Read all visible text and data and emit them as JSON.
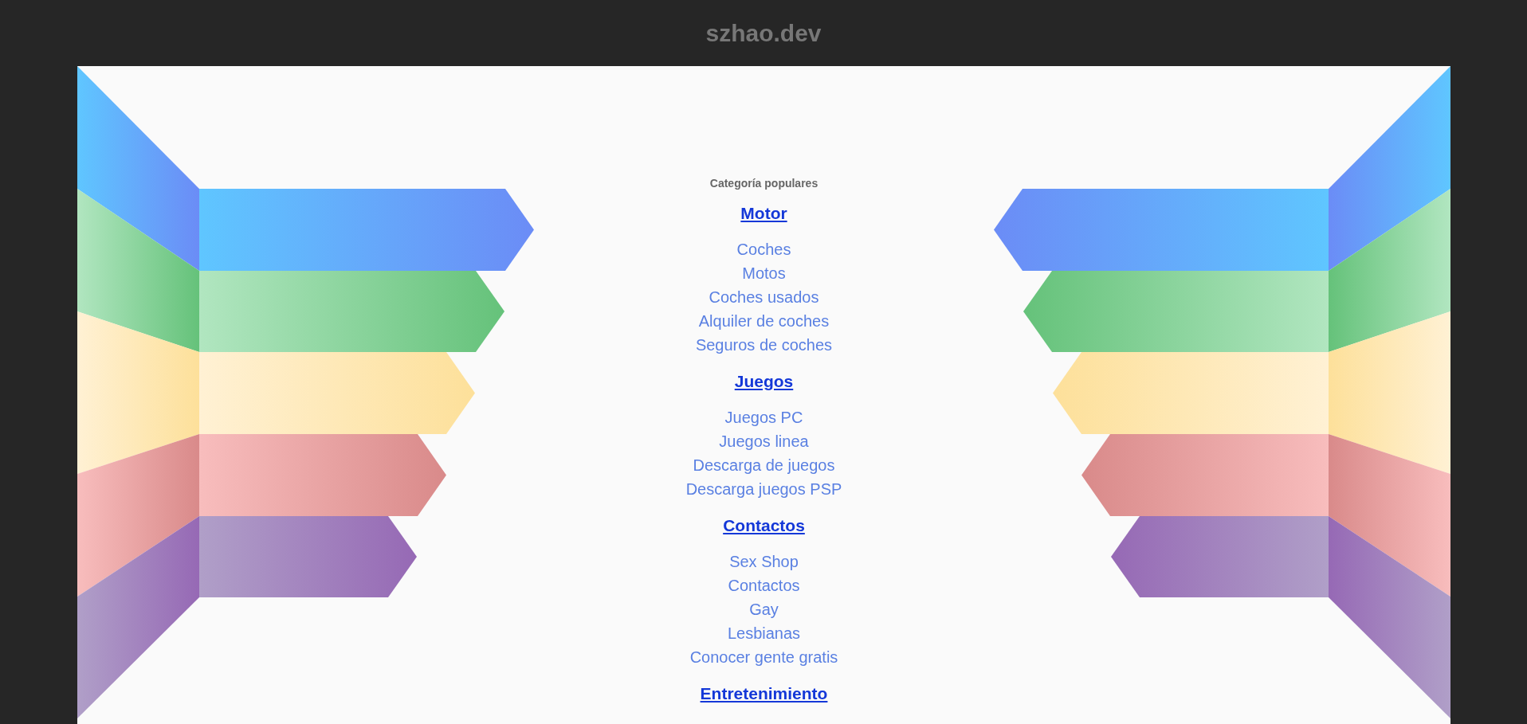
{
  "site_title": "szhao.dev",
  "section_title": "Categoría populares",
  "categories": [
    {
      "title": "Motor",
      "links": [
        "Coches",
        "Motos",
        "Coches usados",
        "Alquiler de coches",
        "Seguros de coches"
      ]
    },
    {
      "title": "Juegos",
      "links": [
        "Juegos PC",
        "Juegos linea",
        "Descarga de juegos",
        "Descarga juegos PSP"
      ]
    },
    {
      "title": "Contactos",
      "links": [
        "Sex Shop",
        "Contactos",
        "Gay",
        "Lesbianas",
        "Conocer gente gratis"
      ]
    },
    {
      "title": "Entretenimiento"
    }
  ]
}
